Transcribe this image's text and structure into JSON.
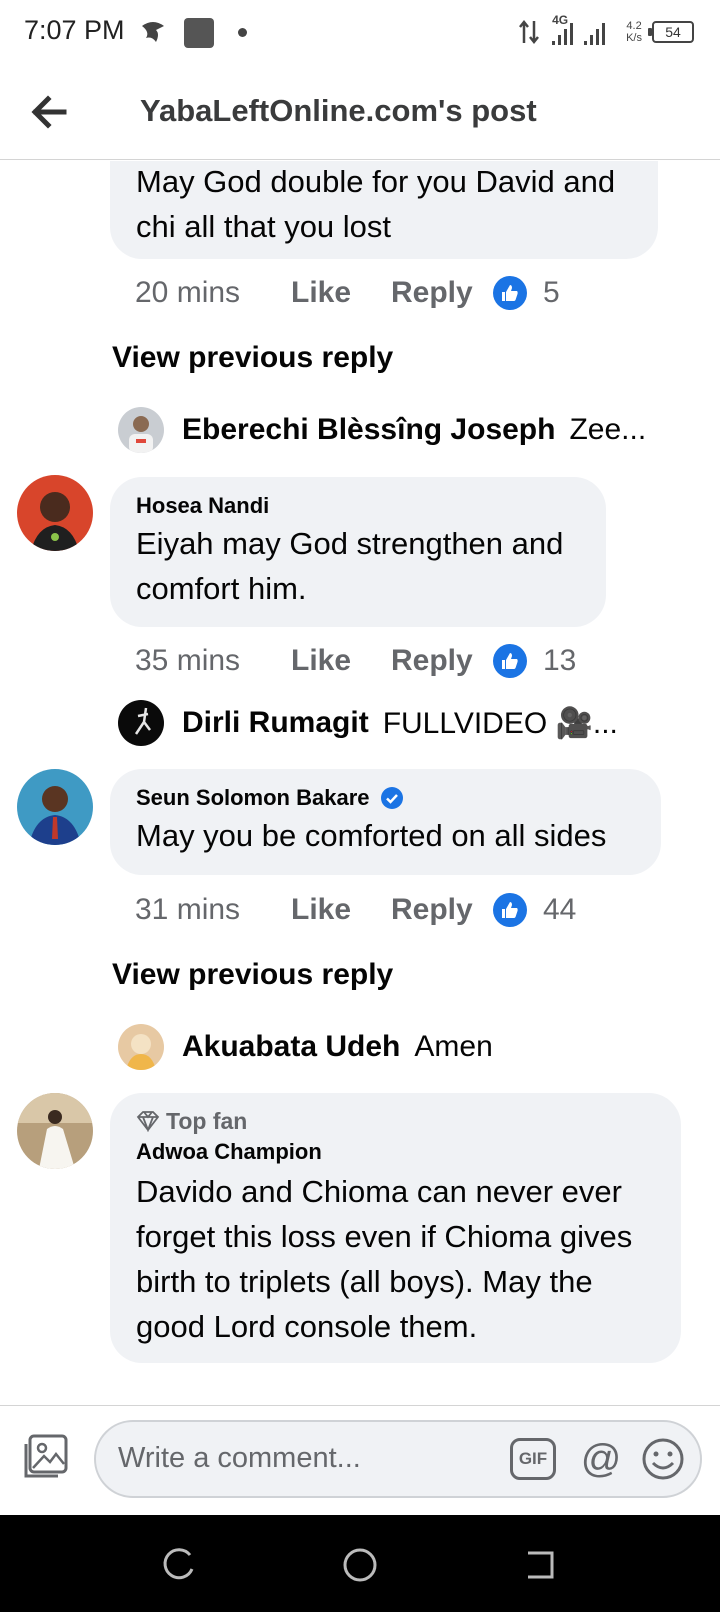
{
  "status_bar": {
    "time": "7:07 PM",
    "network": "4G",
    "speed_value": "4.2",
    "speed_unit": "K/s",
    "battery": "54"
  },
  "header": {
    "title": "YabaLeftOnline.com's post",
    "back_icon": "arrow-left-icon"
  },
  "comments": [
    {
      "text": "May God double for you David and chi all that you lost",
      "time": "20 mins",
      "like_label": "Like",
      "reply_label": "Reply",
      "reactions": "5"
    },
    {
      "author": "Hosea Nandi",
      "text": "Eiyah may God strengthen and comfort him.",
      "time": "35 mins",
      "like_label": "Like",
      "reply_label": "Reply",
      "reactions": "13",
      "reply_preview": {
        "name": "Dirli Rumagit",
        "text": "FULLVIDEO 🎥..."
      }
    },
    {
      "author": "Seun Solomon Bakare",
      "verified": true,
      "text": "May you be comforted on all sides",
      "time": "31 mins",
      "like_label": "Like",
      "reply_label": "Reply",
      "reactions": "44"
    },
    {
      "badge": "Top fan",
      "author": "Adwoa Champion",
      "text": "Davido and Chioma can never ever forget this loss even if Chioma gives birth to triplets (all boys). May the good Lord console them."
    }
  ],
  "view_previous_label": "View previous reply",
  "reply_previews": [
    {
      "name": "Eberechi Blèssîng Joseph",
      "text": "Zee..."
    },
    {
      "name": "Akuabata Udeh",
      "text": "Amen"
    }
  ],
  "composer": {
    "placeholder": "Write a comment...",
    "gif_label": "GIF",
    "at_label": "@"
  },
  "colors": {
    "accent": "#1b74e4",
    "bubble": "#f0f2f5",
    "secondary_text": "#65676b"
  }
}
